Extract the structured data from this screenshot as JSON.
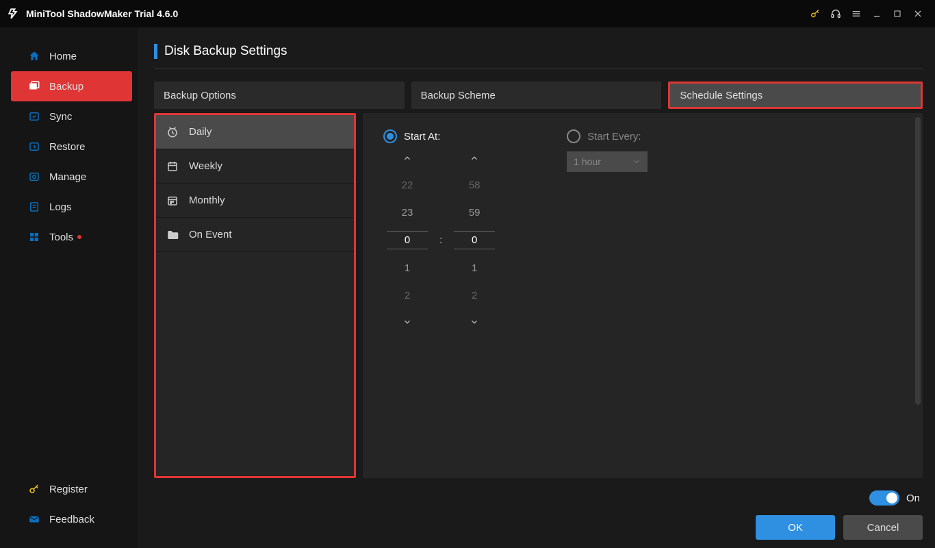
{
  "titlebar": {
    "title": "MiniTool ShadowMaker Trial 4.6.0"
  },
  "sidebar": {
    "items": [
      {
        "label": "Home"
      },
      {
        "label": "Backup"
      },
      {
        "label": "Sync"
      },
      {
        "label": "Restore"
      },
      {
        "label": "Manage"
      },
      {
        "label": "Logs"
      },
      {
        "label": "Tools"
      }
    ],
    "bottom": [
      {
        "label": "Register"
      },
      {
        "label": "Feedback"
      }
    ]
  },
  "page": {
    "title": "Disk Backup Settings"
  },
  "tabs": [
    {
      "label": "Backup Options"
    },
    {
      "label": "Backup Scheme"
    },
    {
      "label": "Schedule Settings"
    }
  ],
  "freq": [
    {
      "label": "Daily"
    },
    {
      "label": "Weekly"
    },
    {
      "label": "Monthly"
    },
    {
      "label": "On Event"
    }
  ],
  "schedule": {
    "start_at_label": "Start At:",
    "start_every_label": "Start Every:",
    "interval_value": "1 hour",
    "hour_values": [
      "22",
      "23",
      "0",
      "1",
      "2"
    ],
    "minute_values": [
      "58",
      "59",
      "0",
      "1",
      "2"
    ],
    "separator": ":"
  },
  "footer": {
    "toggle_label": "On",
    "ok_label": "OK",
    "cancel_label": "Cancel"
  }
}
